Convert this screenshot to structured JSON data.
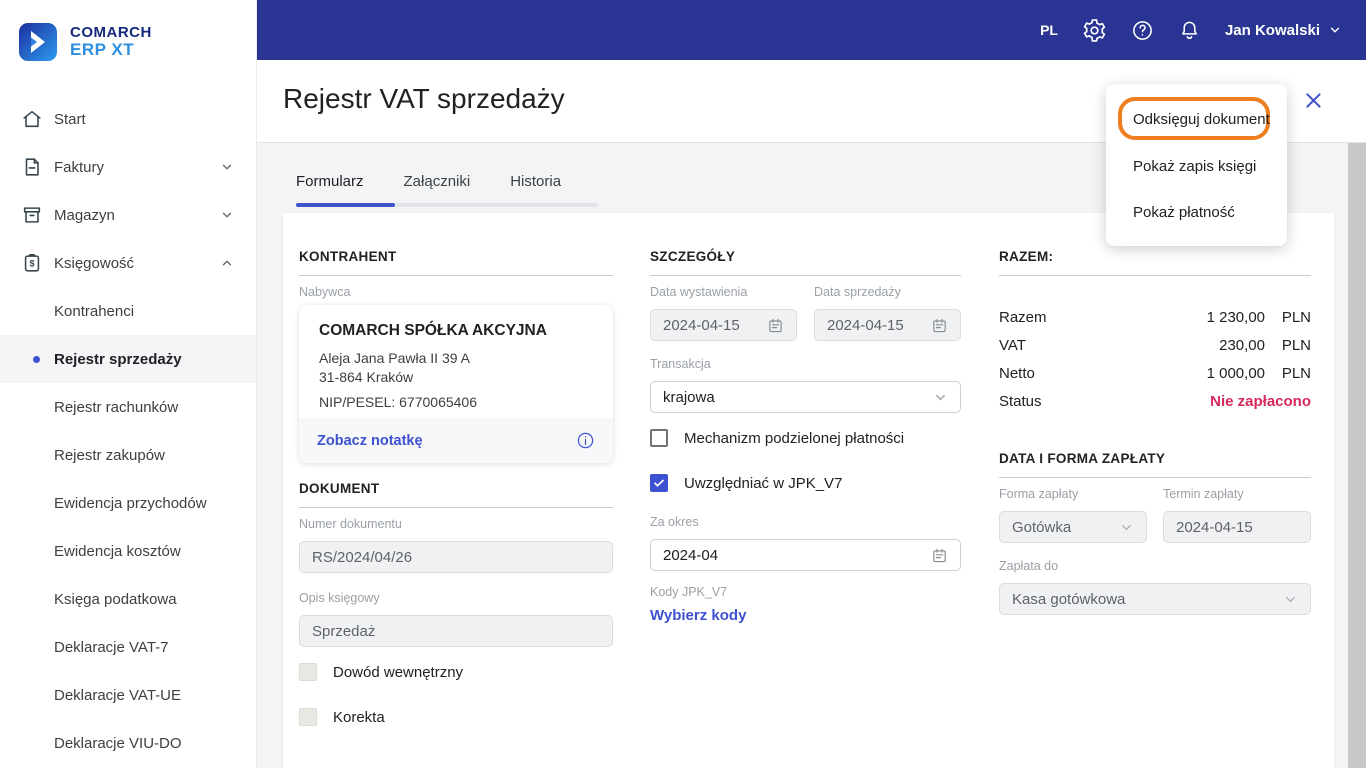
{
  "brand": {
    "line1": "COMARCH",
    "line2": "ERP XT"
  },
  "topbar": {
    "language": "PL",
    "user_name": "Jan Kowalski"
  },
  "sidebar": {
    "items": [
      {
        "label": "Start"
      },
      {
        "label": "Faktury"
      },
      {
        "label": "Magazyn"
      },
      {
        "label": "Księgowość"
      }
    ],
    "subitems": [
      {
        "label": "Kontrahenci"
      },
      {
        "label": "Rejestr sprzedaży"
      },
      {
        "label": "Rejestr rachunków"
      },
      {
        "label": "Rejestr zakupów"
      },
      {
        "label": "Ewidencja przychodów"
      },
      {
        "label": "Ewidencja kosztów"
      },
      {
        "label": "Księga podatkowa"
      },
      {
        "label": "Deklaracje VAT-7"
      },
      {
        "label": "Deklaracje VAT-UE"
      },
      {
        "label": "Deklaracje VIU-DO"
      }
    ]
  },
  "page": {
    "title": "Rejestr VAT sprzedaży"
  },
  "tabs": [
    {
      "label": "Formularz"
    },
    {
      "label": "Załączniki"
    },
    {
      "label": "Historia"
    }
  ],
  "menu_popup": {
    "items": [
      "Odksięguj dokument",
      "Pokaż zapis księgi",
      "Pokaż płatność"
    ]
  },
  "kontrahent": {
    "section_title": "KONTRAHENT",
    "buyer_label": "Nabywca",
    "name": "COMARCH SPÓŁKA AKCYJNA",
    "address_line1": "Aleja Jana Pawła II 39 A",
    "address_line2": "31-864 Kraków",
    "nip": "NIP/PESEL: 6770065406",
    "note_link": "Zobacz notatkę"
  },
  "dokument": {
    "section_title": "DOKUMENT",
    "number_label": "Numer dokumentu",
    "number_value": "RS/2024/04/26",
    "desc_label": "Opis księgowy",
    "desc_value": "Sprzedaż",
    "internal_doc_label": "Dowód wewnętrzny",
    "correction_label": "Korekta"
  },
  "szczegoly": {
    "section_title": "SZCZEGÓŁY",
    "issue_date_label": "Data wystawienia",
    "issue_date_value": "2024-04-15",
    "sale_date_label": "Data sprzedaży",
    "sale_date_value": "2024-04-15",
    "transaction_label": "Transakcja",
    "transaction_value": "krajowa",
    "split_payment_label": "Mechanizm podzielonej płatności",
    "jpk_label": "Uwzględniać w JPK_V7",
    "period_label": "Za okres",
    "period_value": "2024-04",
    "jpk_codes_label": "Kody JPK_V7",
    "jpk_codes_link": "Wybierz kody"
  },
  "razem": {
    "section_title": "RAZEM:",
    "rows": [
      {
        "label": "Razem",
        "value": "1 230,00",
        "currency": "PLN"
      },
      {
        "label": "VAT",
        "value": "230,00",
        "currency": "PLN"
      },
      {
        "label": "Netto",
        "value": "1 000,00",
        "currency": "PLN"
      }
    ],
    "status_label": "Status",
    "status_value": "Nie zapłacono"
  },
  "zaplata": {
    "section_title": "DATA I FORMA ZAPŁATY",
    "form_label": "Forma zapłaty",
    "form_value": "Gotówka",
    "due_label": "Termin zapłaty",
    "due_value": "2024-04-15",
    "pay_to_label": "Zapłata do",
    "pay_to_value": "Kasa gotówkowa"
  },
  "colors": {
    "topbar": "#2a3492",
    "accent": "#3e51cf",
    "highlight_orange": "#ee7e1f",
    "status_red": "#d5295b"
  },
  "icons": {
    "sidebar": [
      "home-icon",
      "invoice-icon",
      "warehouse-icon",
      "accounting-icon"
    ],
    "topbar": [
      "settings-icon",
      "help-icon",
      "notifications-icon",
      "chevron-down-icon"
    ],
    "other": [
      "comarch-logo-icon",
      "close-icon",
      "calendar-icon",
      "info-icon",
      "checkmark-icon"
    ]
  }
}
